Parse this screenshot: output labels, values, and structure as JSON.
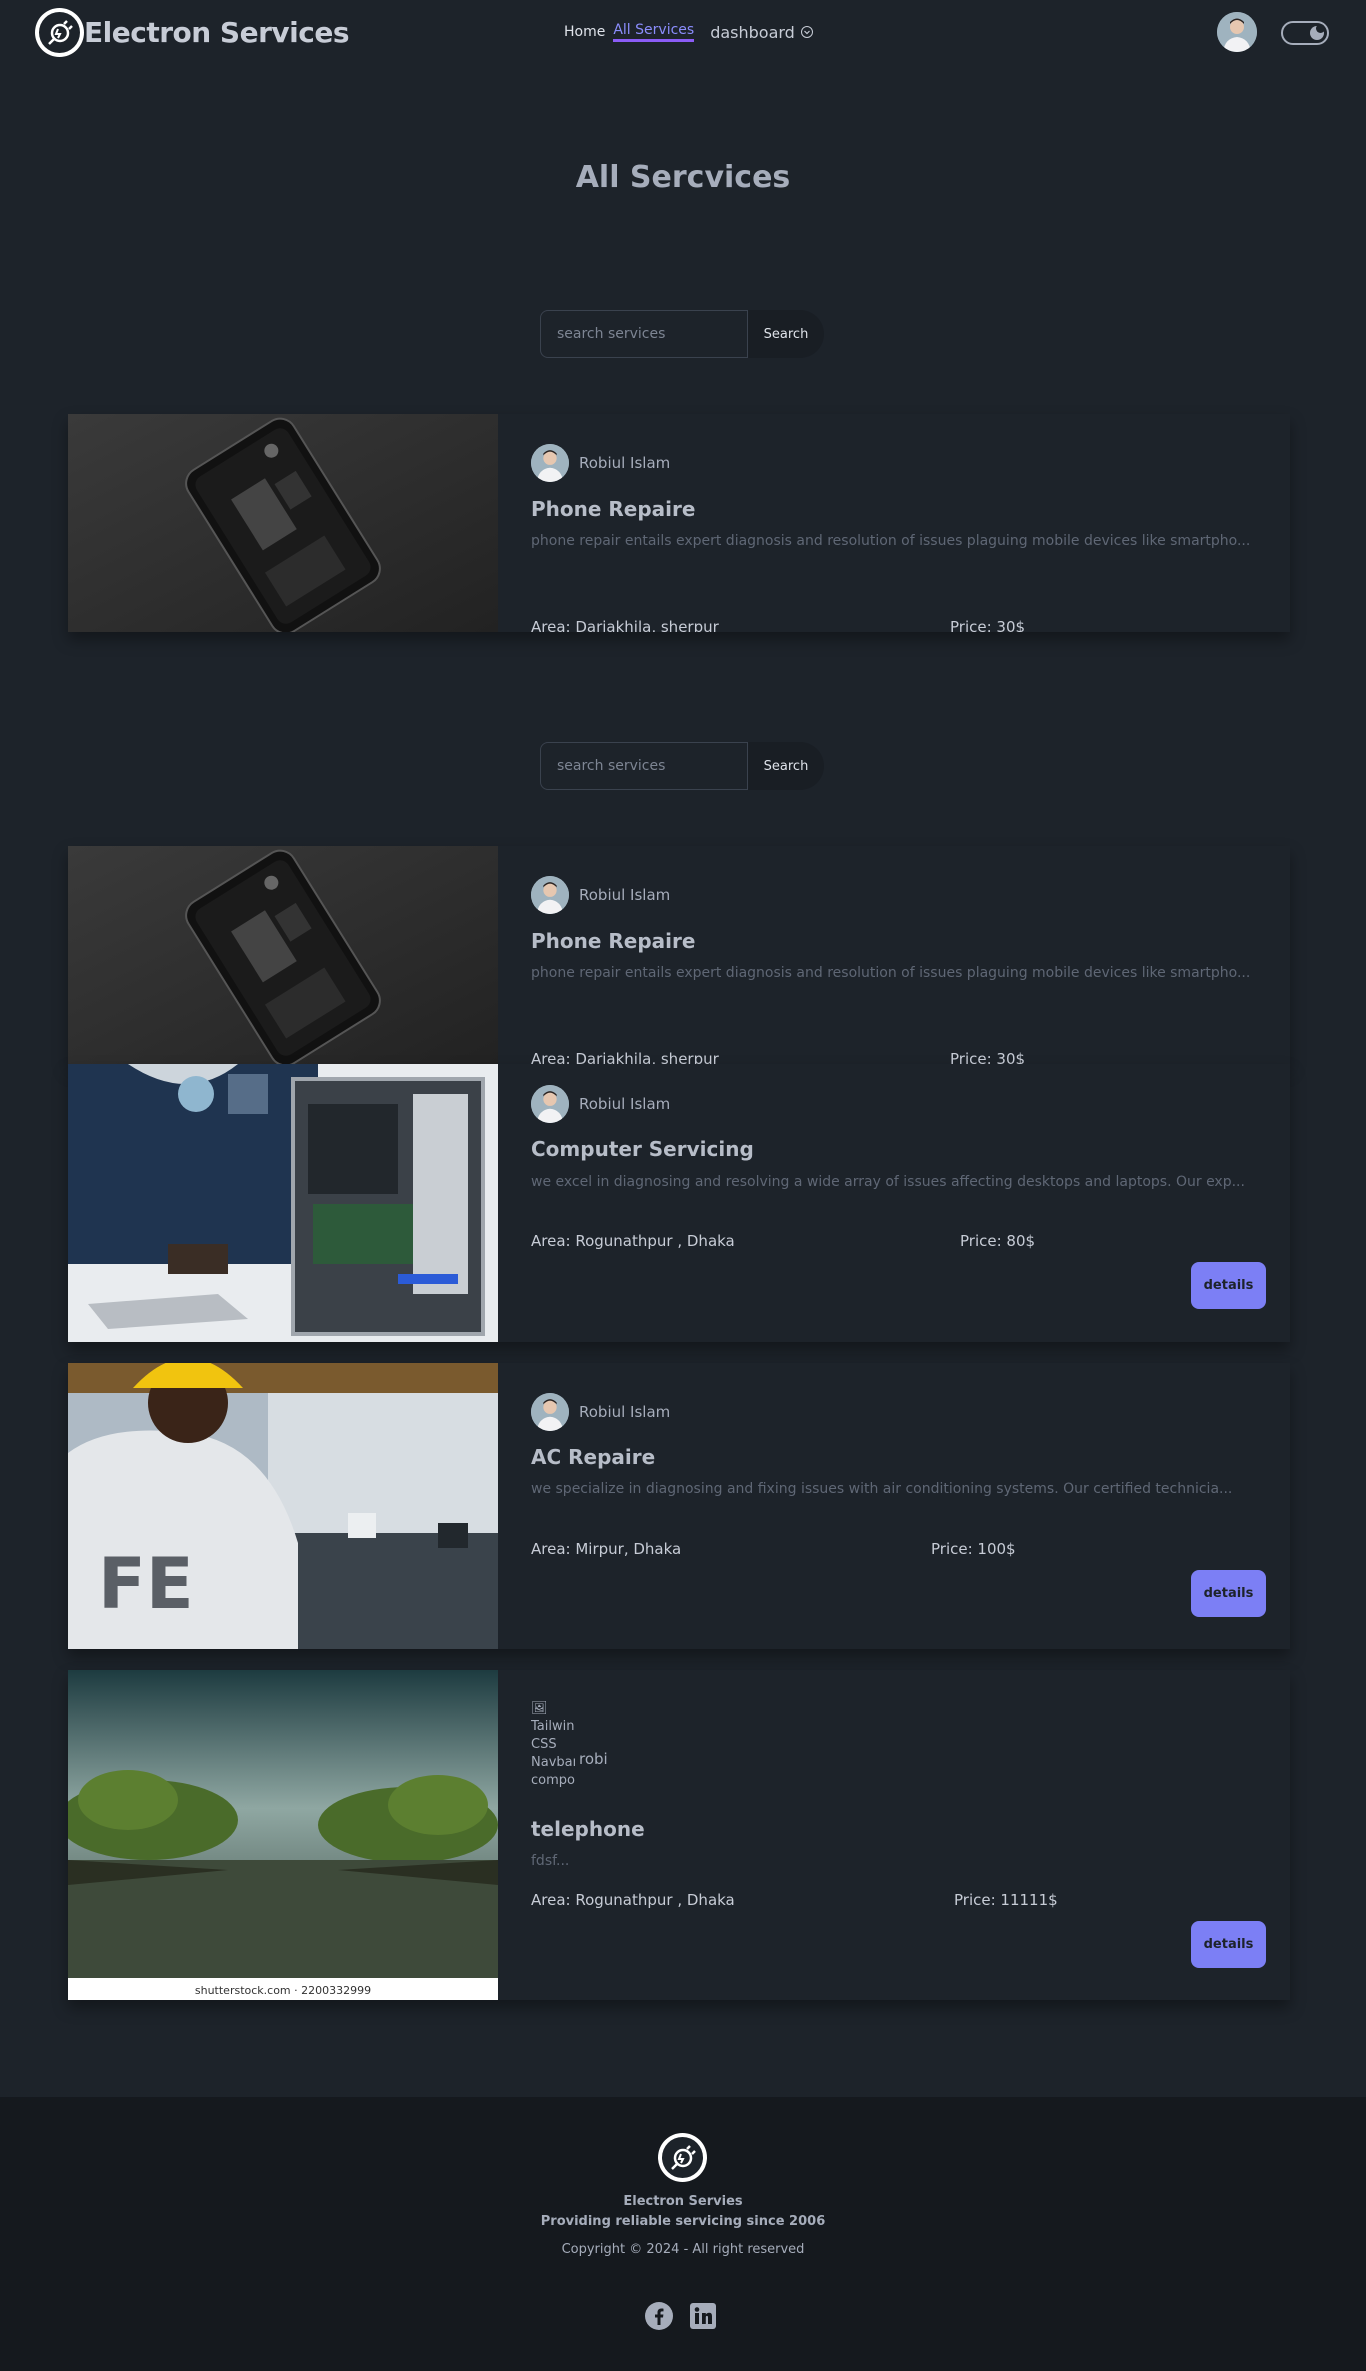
{
  "nav": {
    "brand": "Electron Services",
    "links": [
      "Home",
      "All Services",
      "dashboard"
    ]
  },
  "page": {
    "title": "All Sercvices"
  },
  "search": {
    "placeholder": "search services",
    "button": "Search"
  },
  "cards": [
    {
      "author": "Robiul Islam",
      "title": "Phone Repaire",
      "description": "phone repair entails expert diagnosis and resolution of issues plaguing mobile devices like smartpho...",
      "area": "Area: Dariakhila, sherpur",
      "price": "Price: 30$"
    },
    {
      "author": "Robiul Islam",
      "title": "Phone Repaire",
      "description": "phone repair entails expert diagnosis and resolution of issues plaguing mobile devices like smartpho...",
      "area": "Area: Dariakhila, sherpur",
      "price": "Price: 30$"
    },
    {
      "author": "Robiul Islam",
      "title": "Computer Servicing",
      "description": "we excel in diagnosing and resolving a wide array of issues affecting desktops and laptops. Our exp...",
      "area": "Area: Rogunathpur , Dhaka",
      "price": "Price: 80$",
      "button": "details"
    },
    {
      "author": "Robiul Islam",
      "title": "AC Repaire",
      "description": "we specialize in diagnosing and fixing issues with air conditioning systems. Our certified technicia...",
      "area": "Area: Mirpur, Dhaka",
      "price": "Price: 100$",
      "button": "details"
    },
    {
      "author": "robi",
      "author_img_alt": "Tailwind CSS Navbar component",
      "title": "telephone",
      "description": "fdsf...",
      "area": "Area: Rogunathpur , Dhaka",
      "price": "Price: 11111$",
      "button": "details",
      "image_caption": "shutterstock.com · 2200332999"
    }
  ],
  "footer": {
    "name": "Electron Servies",
    "tagline": "Providing reliable servicing since 2006",
    "copyright": "Copyright © 2024 - All right reserved",
    "social": [
      "facebook-icon",
      "linkedin-icon"
    ]
  },
  "colors": {
    "background": "#1d232a",
    "footer": "#15191e",
    "accent": "#7c7ff5",
    "active_link": "#8b8dfc"
  }
}
